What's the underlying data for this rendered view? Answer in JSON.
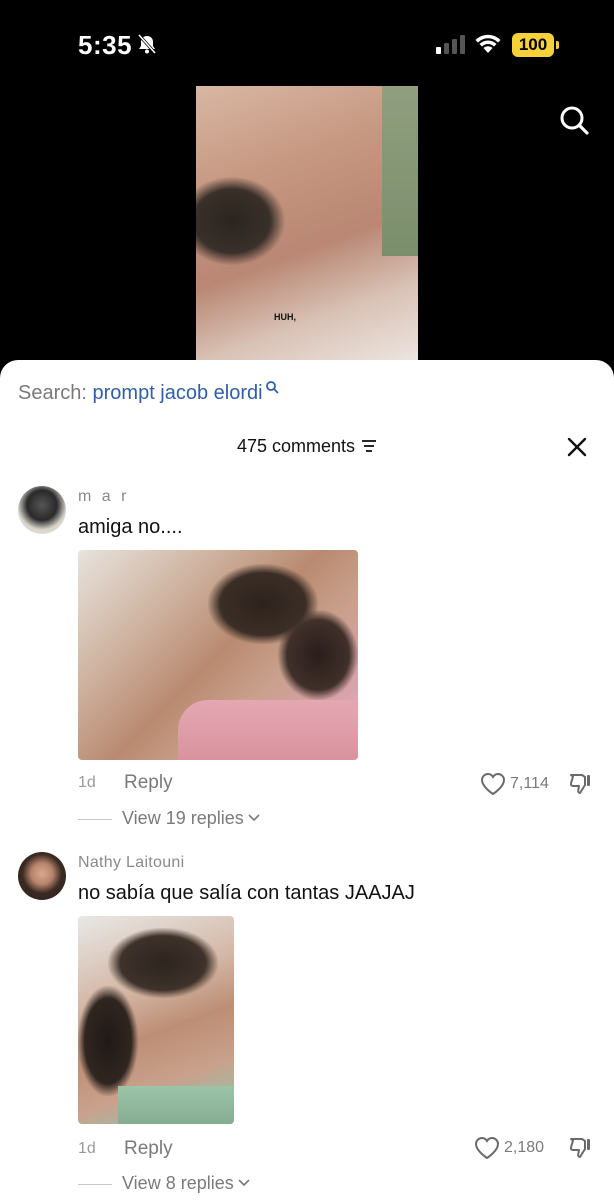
{
  "status_bar": {
    "time": "5:35",
    "battery": "100",
    "battery_color": "#f6d13a"
  },
  "video": {
    "caption": "HUH,",
    "search_icon": "search-icon"
  },
  "search": {
    "label": "Search:",
    "query": "prompt jacob elordi",
    "query_color": "#2f5fa8"
  },
  "comments_header": {
    "count_label": "475 comments"
  },
  "comments": [
    {
      "username": "m a r",
      "text": "amiga no....",
      "time": "1d",
      "reply_label": "Reply",
      "likes": "7,114",
      "view_replies": "View 19 replies"
    },
    {
      "username": "Nathy Laitouni",
      "text": "no sabía que salía con tantas JAAJAJ",
      "time": "1d",
      "reply_label": "Reply",
      "likes": "2,180",
      "view_replies": "View 8 replies"
    }
  ]
}
